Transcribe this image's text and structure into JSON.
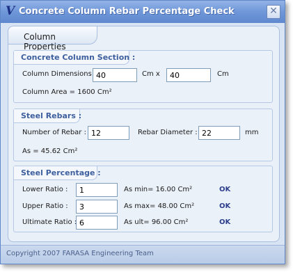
{
  "window": {
    "title": "Concrete Column Rebar Percentage Check",
    "close_glyph": "✕",
    "icon_glyph": "V"
  },
  "panel": {
    "title": "Column Properties"
  },
  "section": {
    "title": "Concrete Column Section :",
    "dimensions_label": "Column Dimensions:",
    "width_value": "40",
    "width_unit": "Cm  x",
    "depth_value": "40",
    "depth_unit": "Cm",
    "area_text": "Column Area = 1600 Cm²"
  },
  "rebars": {
    "title": "Steel Rebars :",
    "count_label": "Number of Rebar :",
    "count_value": "12",
    "diameter_label": "Rebar Diameter :",
    "diameter_value": "22",
    "diameter_unit": "mm",
    "as_text": "As = 45.62 Cm²"
  },
  "percentage": {
    "title": "Steel Percentage :",
    "rows": [
      {
        "label": "Lower Ratio    :",
        "value": "1",
        "result": "As min= 16.00 Cm²",
        "status": "OK"
      },
      {
        "label": "Upper Ratio     :",
        "value": "3",
        "result": "As max= 48.00 Cm²",
        "status": "OK"
      },
      {
        "label": "Ultimate Ratio :",
        "value": "6",
        "result": "As ult= 96.00 Cm²",
        "status": "OK"
      }
    ]
  },
  "footer": {
    "text": "Copyright 2007 FARASA Engineering Team"
  }
}
